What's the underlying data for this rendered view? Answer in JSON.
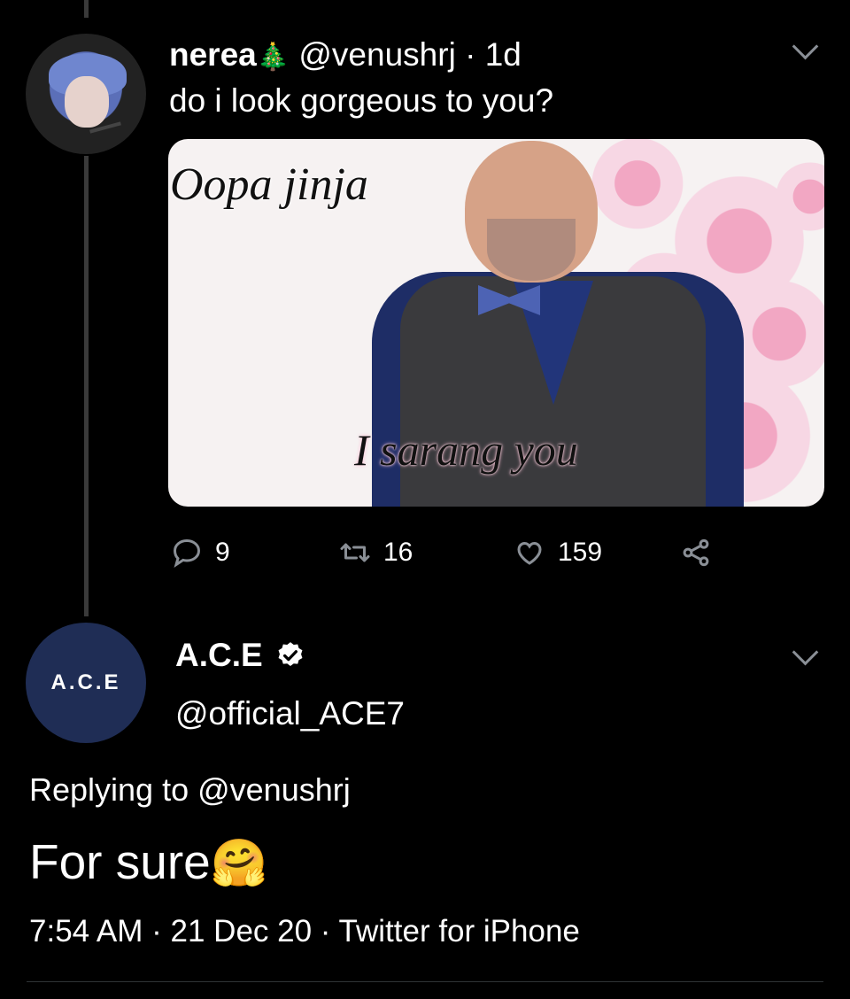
{
  "tweet1": {
    "display_name": "nerea",
    "name_emoji": "🎄",
    "handle": "@venushrj",
    "separator": " · ",
    "time": "1d",
    "text": "do i look gorgeous to you?",
    "media": {
      "caption_top": "Oopa jinja",
      "caption_bottom": "I sarang you"
    },
    "actions": {
      "replies": "9",
      "retweets": "16",
      "likes": "159"
    }
  },
  "tweet2": {
    "display_name": "A.C.E",
    "verified": true,
    "avatar_text": "A.C.E",
    "handle": "@official_ACE7",
    "replying_to": "Replying to @venushrj",
    "text": "For sure",
    "text_emoji": "🤗",
    "footer": "7:54 AM · 21 Dec 20 · Twitter for iPhone"
  },
  "colors": {
    "background": "#000000",
    "icon_gray": "#8a8f96",
    "thread_line": "#3a3a3a",
    "ace_avatar": "#1f2d55"
  },
  "icons": [
    "reply-icon",
    "retweet-icon",
    "like-icon",
    "share-icon",
    "chevron-down-icon",
    "verified-badge-icon"
  ]
}
